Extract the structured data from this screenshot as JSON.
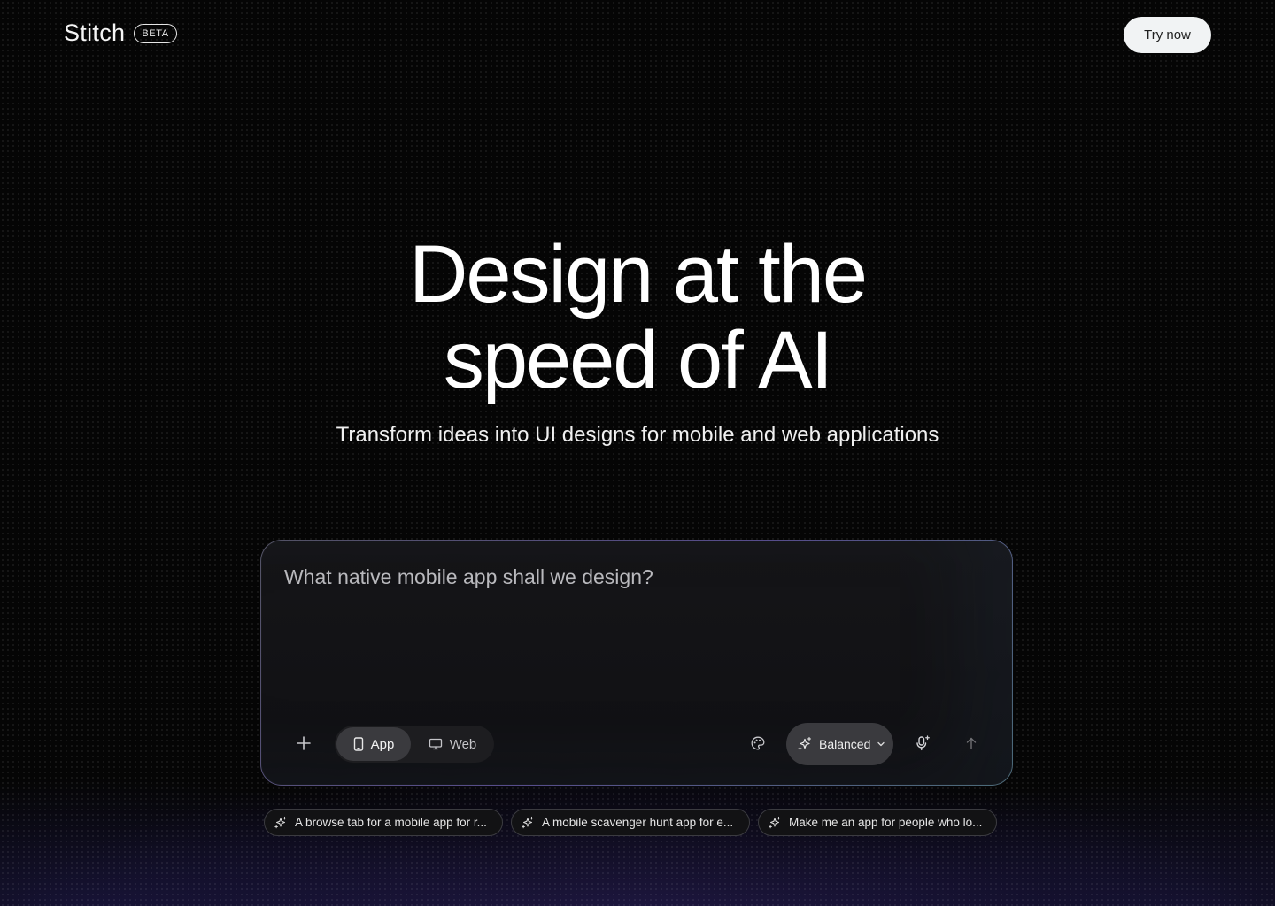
{
  "header": {
    "logo_text": "Stitch",
    "badge": "BETA",
    "cta_label": "Try now"
  },
  "hero": {
    "title_line1": "Design at the",
    "title_line2": "speed of AI",
    "subtitle": "Transform ideas into UI designs for mobile and web applications"
  },
  "prompt": {
    "placeholder": "What native mobile app shall we design?",
    "value": "",
    "modes": [
      {
        "label": "App",
        "icon": "smartphone-icon",
        "selected": true
      },
      {
        "label": "Web",
        "icon": "monitor-icon",
        "selected": false
      }
    ],
    "model_label": "Balanced",
    "icons": {
      "add": "plus-icon",
      "theme": "palette-icon",
      "model": "sparkle-icon",
      "dropdown": "chevron-down-icon",
      "voice": "mic-sparkle-icon",
      "send": "arrow-up-icon"
    }
  },
  "suggestions": [
    {
      "label": "A browse tab for a mobile app for r...",
      "icon": "sparkle-icon"
    },
    {
      "label": "A mobile scavenger hunt app for e...",
      "icon": "sparkle-icon"
    },
    {
      "label": "Make me an app for people who lo...",
      "icon": "sparkle-icon"
    }
  ],
  "colors": {
    "background": "#050505",
    "accent_glow": "#4634a0",
    "cta_bg": "#f1f3f4",
    "chip_border": "#3b3b40",
    "active_toggle": "#3a3a3e"
  }
}
